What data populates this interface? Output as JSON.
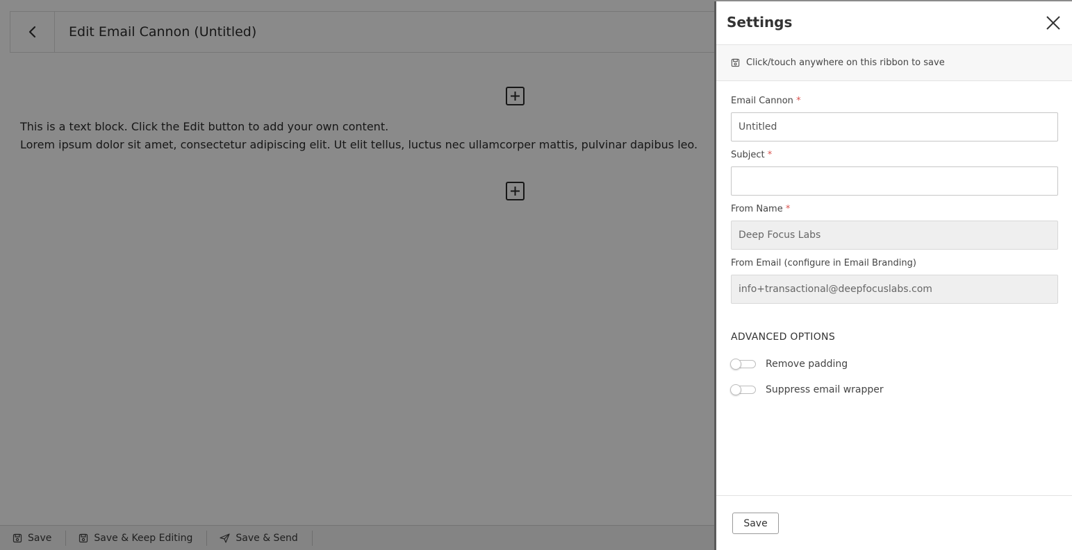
{
  "editor": {
    "title": "Edit Email Cannon (Untitled)",
    "text_block": {
      "line1": "This is a text block. Click the Edit button to add your own content.",
      "line2": "Lorem ipsum dolor sit amet, consectetur adipiscing elit. Ut elit tellus, luctus nec ullamcorper mattis, pulvinar dapibus leo."
    },
    "bottom_bar": {
      "save": "Save",
      "save_keep_editing": "Save & Keep Editing",
      "save_send": "Save & Send"
    }
  },
  "settings": {
    "title": "Settings",
    "ribbon_text": "Click/touch anywhere on this ribbon to save",
    "fields": {
      "email_cannon": {
        "label": "Email Cannon",
        "required": "*",
        "value": "Untitled"
      },
      "subject": {
        "label": "Subject",
        "required": "*",
        "value": ""
      },
      "from_name": {
        "label": "From Name",
        "required": "*",
        "value": "Deep Focus Labs"
      },
      "from_email": {
        "label": "From Email (configure in Email Branding)",
        "value": "info+transactional@deepfocuslabs.com"
      }
    },
    "advanced_title": "ADVANCED OPTIONS",
    "toggles": {
      "remove_padding": {
        "label": "Remove padding",
        "on": false
      },
      "suppress_wrapper": {
        "label": "Suppress email wrapper",
        "on": false
      }
    },
    "footer_save": "Save"
  },
  "colors": {
    "overlay": "#000000",
    "required_mark": "#d9534f",
    "panel_border": "#5a5a5a"
  }
}
